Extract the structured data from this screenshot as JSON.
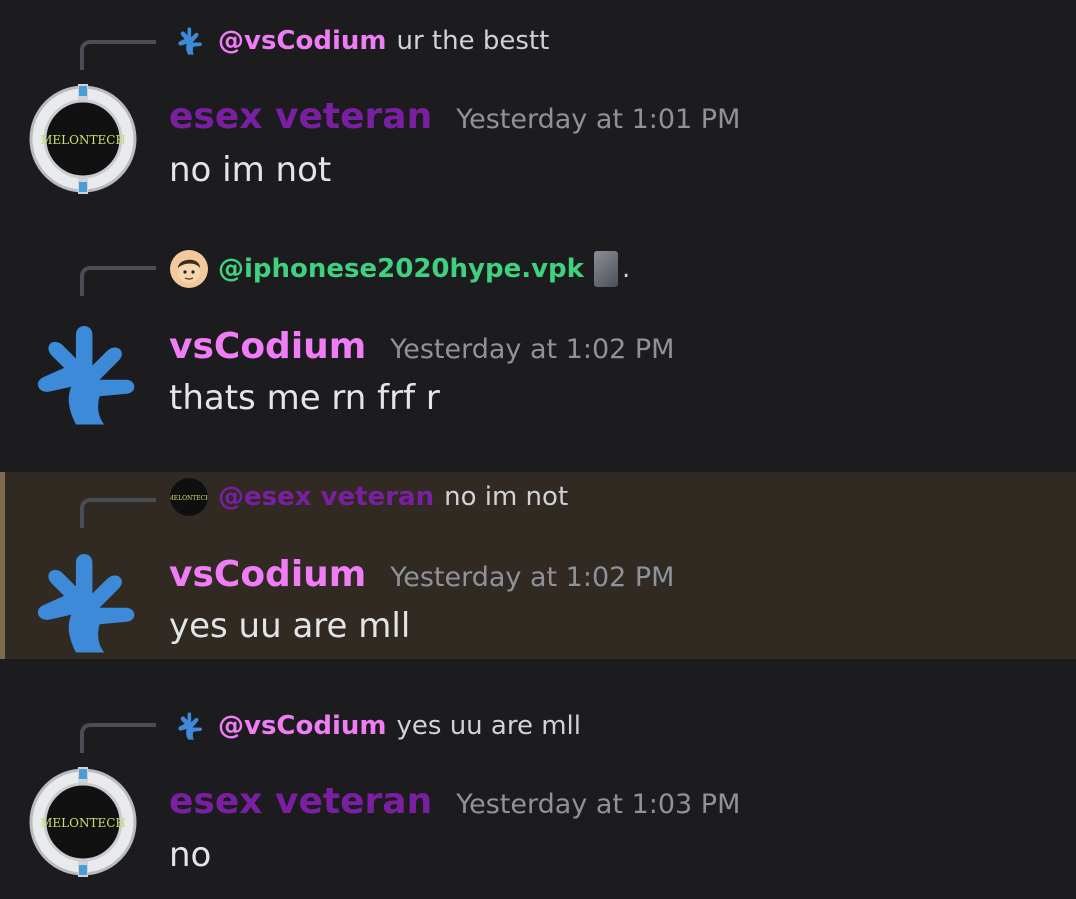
{
  "messages": [
    {
      "reply": {
        "mention": "@vsCodium",
        "text": "ur the bestt"
      },
      "author": "esex veteran",
      "timestamp": "Yesterday at 1:01 PM",
      "body": "no im not"
    },
    {
      "reply": {
        "mention": "@iphonese2020hype.vpk",
        "text": "."
      },
      "author": "vsCodium",
      "timestamp": "Yesterday at 1:02 PM",
      "body": "thats me rn frf r"
    },
    {
      "reply": {
        "mention": "@esex veteran",
        "text": "no im not"
      },
      "author": "vsCodium",
      "timestamp": "Yesterday at 1:02 PM",
      "body": "yes uu are mll",
      "highlighted": true
    },
    {
      "reply": {
        "mention": "@vsCodium",
        "text": "yes uu are mll"
      },
      "author": "esex veteran",
      "timestamp": "Yesterday at 1:03 PM",
      "body": "no"
    }
  ],
  "avatar_text": "MELONTECH",
  "icons": {
    "vscodium": "vscodium-logo-icon",
    "esex": "portal-core-avatar",
    "iphone": "cartoon-face-avatar",
    "attachment": "image-attachment-icon"
  },
  "colors": {
    "background": "#1c1c1f",
    "highlight": "#302a23",
    "esex_name": "#7b1fa2",
    "vscodium_name": "#f07cf6",
    "iphone_name": "#3fd17f",
    "timestamp": "#8f929a"
  }
}
